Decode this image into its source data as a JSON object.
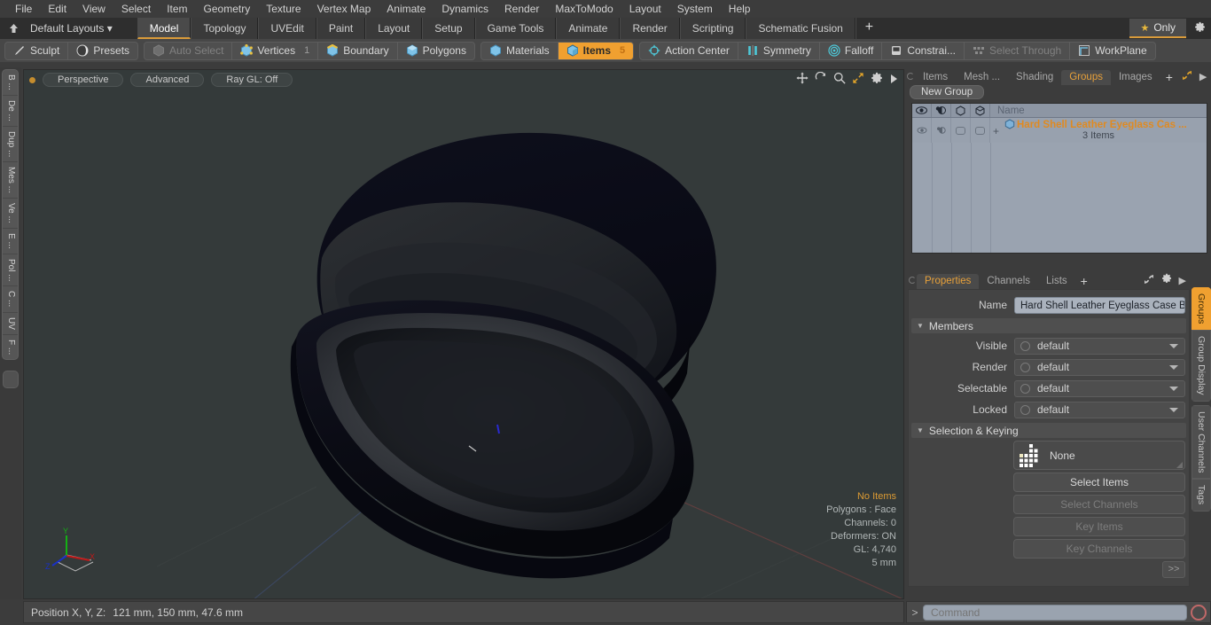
{
  "menubar": {
    "items": [
      "File",
      "Edit",
      "View",
      "Select",
      "Item",
      "Geometry",
      "Texture",
      "Vertex Map",
      "Animate",
      "Dynamics",
      "Render",
      "MaxToModo",
      "Layout",
      "System",
      "Help"
    ]
  },
  "layoutrow": {
    "home_icon": "home-icon",
    "layout_name": "Default Layouts ▾",
    "tabs": [
      {
        "label": "Model",
        "active": true
      },
      {
        "label": "Topology",
        "active": false
      },
      {
        "label": "UVEdit",
        "active": false
      },
      {
        "label": "Paint",
        "active": false
      },
      {
        "label": "Layout",
        "active": false
      },
      {
        "label": "Setup",
        "active": false
      },
      {
        "label": "Game Tools",
        "active": false
      },
      {
        "label": "Animate",
        "active": false
      },
      {
        "label": "Render",
        "active": false
      },
      {
        "label": "Scripting",
        "active": false
      },
      {
        "label": "Schematic Fusion",
        "active": false
      }
    ],
    "add_label": "+",
    "only_label": "Only",
    "gear_icon": "gear-icon"
  },
  "modebar": {
    "group1": [
      {
        "label": "Sculpt",
        "icon": "pencil-icon",
        "state": "normal",
        "count": ""
      },
      {
        "label": "Presets",
        "icon": "sphere-icon",
        "state": "normal",
        "count": ""
      }
    ],
    "group2": [
      {
        "label": "Auto Select",
        "icon": "cube-grey-icon",
        "state": "disabled",
        "count": ""
      },
      {
        "label": "Vertices",
        "icon": "cube-vertex-icon",
        "state": "normal",
        "count": "1"
      },
      {
        "label": "Boundary",
        "icon": "cube-edge-icon",
        "state": "normal",
        "count": ""
      },
      {
        "label": "Polygons",
        "icon": "cube-poly-icon",
        "state": "normal",
        "count": ""
      }
    ],
    "group3": [
      {
        "label": "Materials",
        "icon": "cube-material-icon",
        "state": "normal",
        "count": ""
      },
      {
        "label": "Items",
        "icon": "cube-items-icon",
        "state": "active",
        "count": "5"
      }
    ],
    "group4": [
      {
        "label": "Action Center",
        "icon": "target-icon",
        "state": "normal",
        "count": ""
      },
      {
        "label": "Symmetry",
        "icon": "symmetry-icon",
        "state": "normal",
        "count": ""
      },
      {
        "label": "Falloff",
        "icon": "falloff-icon",
        "state": "normal",
        "count": ""
      },
      {
        "label": "Constrai...",
        "icon": "constraint-icon",
        "state": "normal",
        "count": ""
      },
      {
        "label": "Select Through",
        "icon": "select-through-icon",
        "state": "disabled",
        "count": ""
      },
      {
        "label": "WorkPlane",
        "icon": "workplane-icon",
        "state": "normal",
        "count": ""
      }
    ]
  },
  "leftbar": {
    "tabs": [
      "B ...",
      "De ...",
      "Dup ...",
      "Mes ...",
      "Ve ...",
      "E ...",
      "Pol ...",
      "C ...",
      "UV",
      "F ..."
    ]
  },
  "viewport": {
    "mode_pill": "Perspective",
    "style_pill": "Advanced",
    "raygl_pill": "Ray GL: Off",
    "icons": [
      "move-icon",
      "rotate-icon",
      "zoom-icon",
      "fit-icon",
      "gear-icon",
      "play-icon"
    ],
    "stats": {
      "items": "No Items",
      "polygons": "Polygons : Face",
      "channels": "Channels: 0",
      "deformers": "Deformers: ON",
      "gl": "GL: 4,740",
      "scale": "5 mm"
    },
    "axis": {
      "x": "X",
      "y": "Y",
      "z": "Z"
    }
  },
  "statusbar": {
    "position_label": "Position X, Y, Z:",
    "position_value": "121 mm, 150 mm, 47.6 mm"
  },
  "rightpanel": {
    "tabs": [
      {
        "label": "Items",
        "active": false
      },
      {
        "label": "Mesh ...",
        "active": false
      },
      {
        "label": "Shading",
        "active": false
      },
      {
        "label": "Groups",
        "active": true
      },
      {
        "label": "Images",
        "active": false
      }
    ],
    "add_label": "+",
    "expand_icon": "expand-icon",
    "more_icon": "chevron-right-icon",
    "new_group_label": "New Group",
    "list": {
      "header_icons": [
        "eye-icon",
        "render-icon",
        "select-icon",
        "lock-icon"
      ],
      "name_header": "Name",
      "rows": [
        {
          "title": "Hard Shell Leather Eyeglass Cas ...",
          "subtitle": "3 Items",
          "expander": "+"
        }
      ]
    },
    "properties": {
      "tabs": [
        {
          "label": "Properties",
          "active": true
        },
        {
          "label": "Channels",
          "active": false
        },
        {
          "label": "Lists",
          "active": false
        }
      ],
      "add_label": "+",
      "expand_icon": "expand-icon",
      "gear_icon": "gear-icon",
      "more_icon": "chevron-right-icon",
      "name_label": "Name",
      "name_value": "Hard Shell Leather Eyeglass Case Blac",
      "members_section": "Members",
      "members": [
        {
          "label": "Visible",
          "value": "default"
        },
        {
          "label": "Render",
          "value": "default"
        },
        {
          "label": "Selectable",
          "value": "default"
        },
        {
          "label": "Locked",
          "value": "default"
        }
      ],
      "selection_section": "Selection & Keying",
      "none_label": "None",
      "buttons": [
        {
          "label": "Select Items",
          "disabled": false
        },
        {
          "label": "Select Channels",
          "disabled": true
        },
        {
          "label": "Key Items",
          "disabled": true
        },
        {
          "label": "Key Channels",
          "disabled": true
        }
      ],
      "goto_label": ">>"
    },
    "side_tabs": [
      {
        "label": "Groups",
        "active": true
      },
      {
        "label": "Group Display",
        "active": false
      },
      {
        "label": "User Channels",
        "active": false
      },
      {
        "label": "Tags",
        "active": false
      }
    ]
  },
  "commandbar": {
    "chevron": ">",
    "placeholder": "Command",
    "value": "",
    "record_icon": "record-icon"
  },
  "colors": {
    "accent": "#f0a030",
    "viewport_bg": "#343a3a",
    "panel_bg": "#3c3c3c",
    "list_bg": "#9aa3b0"
  }
}
